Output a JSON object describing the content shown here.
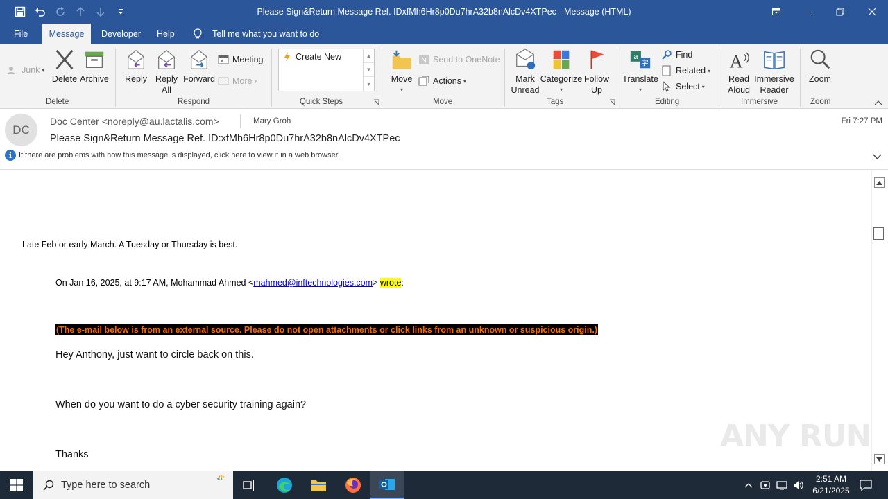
{
  "window": {
    "title": "Please Sign&Return Message Ref. IDxfMh6Hr8p0Du7hrA32b8nAlcDv4XTPec  -  Message (HTML)"
  },
  "tabs": {
    "file": "File",
    "message": "Message",
    "developer": "Developer",
    "help": "Help",
    "tell_me": "Tell me what you want to do"
  },
  "ribbon": {
    "delete_group": {
      "junk": "Junk",
      "delete": "Delete",
      "archive": "Archive",
      "label": "Delete"
    },
    "respond_group": {
      "reply": "Reply",
      "reply_all_1": "Reply",
      "reply_all_2": "All",
      "forward": "Forward",
      "meeting": "Meeting",
      "more": "More",
      "label": "Respond"
    },
    "quicksteps_group": {
      "create_new": "Create New",
      "label": "Quick Steps"
    },
    "move_group": {
      "move": "Move",
      "onenote": "Send to OneNote",
      "actions": "Actions",
      "label": "Move"
    },
    "tags_group": {
      "mark_unread_1": "Mark",
      "mark_unread_2": "Unread",
      "categorize": "Categorize",
      "follow_up_1": "Follow",
      "follow_up_2": "Up",
      "label": "Tags"
    },
    "editing_group": {
      "translate": "Translate",
      "find": "Find",
      "related": "Related",
      "select": "Select",
      "label": "Editing"
    },
    "immersive_group": {
      "read_aloud_1": "Read",
      "read_aloud_2": "Aloud",
      "immersive_reader_1": "Immersive",
      "immersive_reader_2": "Reader",
      "label": "Immersive"
    },
    "zoom_group": {
      "zoom": "Zoom",
      "label": "Zoom"
    }
  },
  "message": {
    "avatar_initials": "DC",
    "sender": "Doc Center <noreply@au.lactalis.com>",
    "recipient": "Mary Groh",
    "sent": "Fri 7:27 PM",
    "subject": "Please Sign&Return Message Ref. ID:xfMh6Hr8p0Du7hrA32b8nAlcDv4XTPec",
    "info_bar": "If there are problems with how this message is displayed, click here to view it in a web browser."
  },
  "body": {
    "line1": "Late Feb or early March. A Tuesday or Thursday is best.",
    "quote_prefix": "On Jan 16, 2025, at 9:17 AM, Mohammad Ahmed <",
    "quote_email": "mahmed@inftechnologies.com",
    "quote_mid": "> ",
    "quote_wrote": "wrote",
    "quote_suffix": ":",
    "warning": "(The e-mail below is from an external source. Please do not open attachments or click links from an unknown or suspicious origin.)",
    "p1": "Hey Anthony, just want to circle back on this.",
    "p2": "When do you want to do a cyber security training again?",
    "p3": "Thanks",
    "watermark": "ANY RUN"
  },
  "taskbar": {
    "search_placeholder": "Type here to search",
    "time": "2:51 AM",
    "date": "6/21/2025"
  },
  "colors": {
    "titlebar": "#2b579a",
    "ribbon": "#f3f3f3",
    "warning_text": "#ff6a00",
    "taskbar": "#1f2a38"
  }
}
